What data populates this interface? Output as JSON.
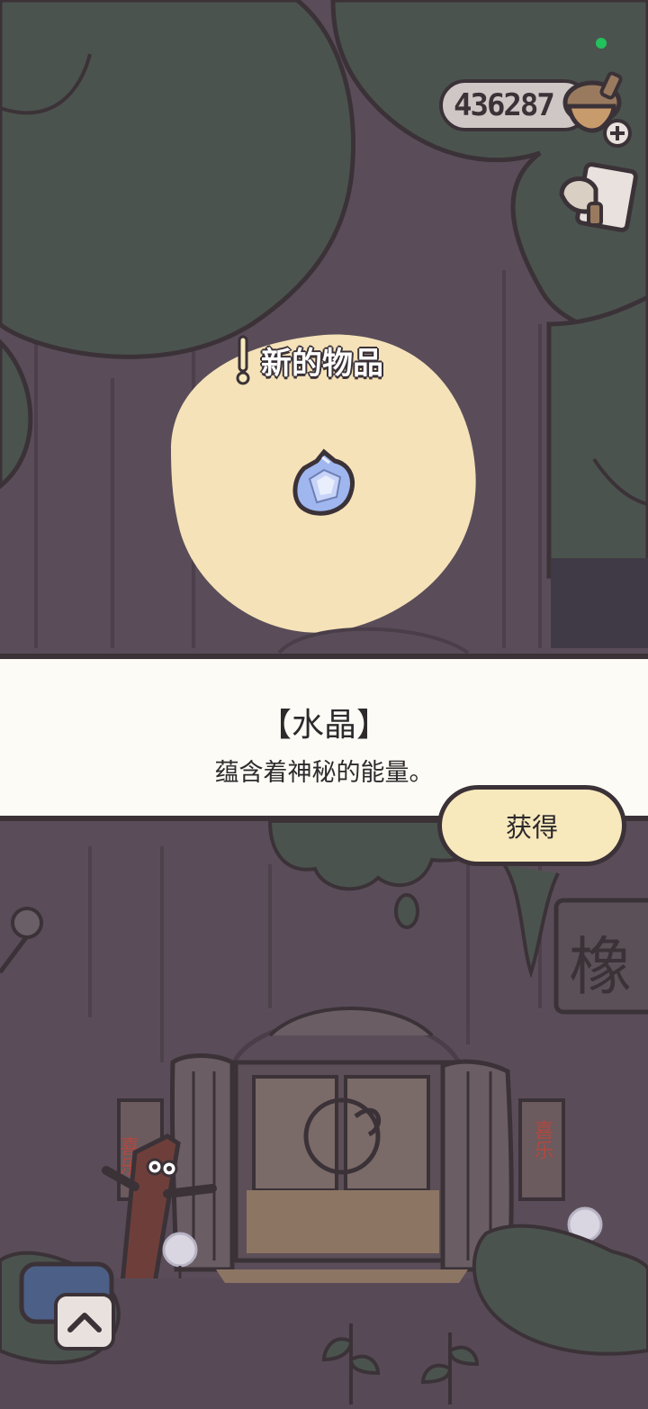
{
  "hud": {
    "acorn_count": "436287",
    "acorn_icon": "acorn-plus-icon",
    "note_icon": "note-icon"
  },
  "reward": {
    "badge_label": "新的物品",
    "item_icon": "crystal-icon",
    "item_name": "【水晶】",
    "item_description": "蕴含着神秘的能量。",
    "obtain_label": "获得"
  },
  "shop_signs": {
    "left_scroll": "喜乐",
    "right_scroll": "喜乐",
    "shop_sign": "橡"
  },
  "controls": {
    "expand_icon": "chevron-up-icon"
  },
  "colors": {
    "spotlight": "#f5e2b8",
    "panel": "#fdfbf6",
    "button": "#f8e9bd",
    "outline": "#3b3238",
    "foliage": "#4b534e",
    "trunk": "#5a4d59"
  }
}
